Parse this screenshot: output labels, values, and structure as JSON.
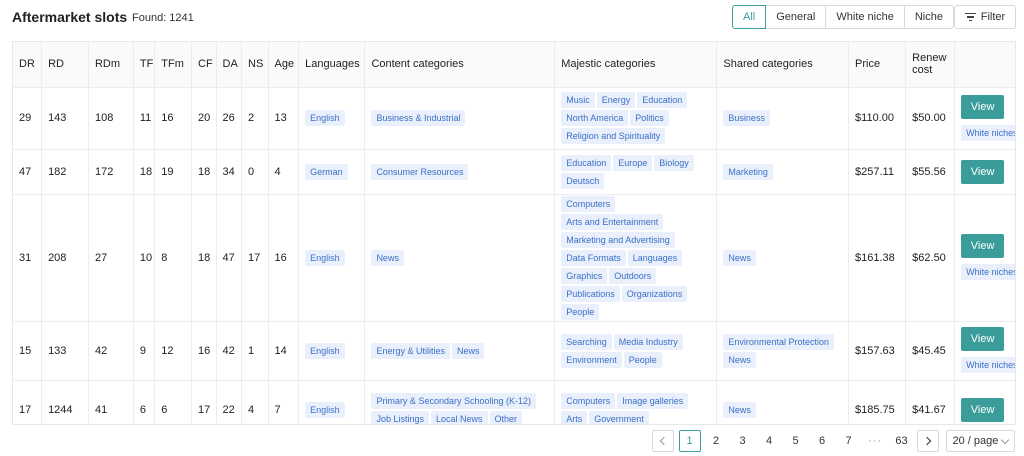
{
  "header": {
    "title": "Aftermarket slots",
    "found": "Found: 1241"
  },
  "segments": [
    {
      "label": "All",
      "active": true
    },
    {
      "label": "General",
      "active": false
    },
    {
      "label": "White niche",
      "active": false
    },
    {
      "label": "Niche",
      "active": false
    }
  ],
  "filter_label": "Filter",
  "columns": [
    "DR",
    "RD",
    "RDm",
    "TF",
    "TFm",
    "CF",
    "DA",
    "NS",
    "Age",
    "Languages",
    "Content categories",
    "Majestic categories",
    "Shared categories",
    "Price",
    "Renew cost",
    ""
  ],
  "rows": [
    {
      "dr": "29",
      "rd": "143",
      "rdm": "108",
      "tf": "11",
      "tfm": "16",
      "cf": "20",
      "da": "26",
      "ns": "2",
      "age": "13",
      "languages": [
        "English"
      ],
      "content": [
        "Business & Industrial"
      ],
      "majestic": [
        "Music",
        "Energy",
        "Education",
        "North America",
        "Politics",
        "Religion and Spirituality"
      ],
      "shared": [
        "Business"
      ],
      "price": "$110.00",
      "renew": "$50.00",
      "view": "View",
      "badge": "White niches"
    },
    {
      "dr": "47",
      "rd": "182",
      "rdm": "172",
      "tf": "18",
      "tfm": "19",
      "cf": "18",
      "da": "34",
      "ns": "0",
      "age": "4",
      "languages": [
        "German"
      ],
      "content": [
        "Consumer Resources"
      ],
      "majestic": [
        "Education",
        "Europe",
        "Biology",
        "Deutsch"
      ],
      "shared": [
        "Marketing"
      ],
      "price": "$257.11",
      "renew": "$55.56",
      "view": "View",
      "badge": ""
    },
    {
      "dr": "31",
      "rd": "208",
      "rdm": "27",
      "tf": "10",
      "tfm": "8",
      "cf": "18",
      "da": "47",
      "ns": "17",
      "age": "16",
      "languages": [
        "English"
      ],
      "content": [
        "News"
      ],
      "majestic": [
        "Computers",
        "Arts and Entertainment",
        "Marketing and Advertising",
        "Data Formats",
        "Languages",
        "Graphics",
        "Outdoors",
        "Publications",
        "Organizations",
        "People"
      ],
      "shared": [
        "News"
      ],
      "price": "$161.38",
      "renew": "$62.50",
      "view": "View",
      "badge": "White niches"
    },
    {
      "dr": "15",
      "rd": "133",
      "rdm": "42",
      "tf": "9",
      "tfm": "12",
      "cf": "16",
      "da": "42",
      "ns": "1",
      "age": "14",
      "languages": [
        "English"
      ],
      "content": [
        "Energy & Utilities",
        "News"
      ],
      "majestic": [
        "Searching",
        "Media Industry",
        "Environment",
        "People"
      ],
      "shared": [
        "Environmental Protection",
        "News"
      ],
      "price": "$157.63",
      "renew": "$45.45",
      "view": "View",
      "badge": "White niches"
    },
    {
      "dr": "17",
      "rd": "1244",
      "rdm": "41",
      "tf": "6",
      "tfm": "6",
      "cf": "17",
      "da": "22",
      "ns": "4",
      "age": "7",
      "languages": [
        "English"
      ],
      "content": [
        "Primary & Secondary Schooling (K-12)",
        "Job Listings",
        "Local News",
        "Other"
      ],
      "majestic": [
        "Computers",
        "Image galleries",
        "Arts",
        "Government"
      ],
      "shared": [
        "News"
      ],
      "price": "$185.75",
      "renew": "$41.67",
      "view": "View",
      "badge": ""
    }
  ],
  "pagination": {
    "pages": [
      "1",
      "2",
      "3",
      "4",
      "5",
      "6",
      "7"
    ],
    "ellipsis": "···",
    "last": "63",
    "page_size": "20 / page",
    "active": "1"
  },
  "colors": {
    "accent": "#3a9d9a",
    "tag_bg": "#e9f0fb",
    "tag_text": "#3b6fc7"
  }
}
